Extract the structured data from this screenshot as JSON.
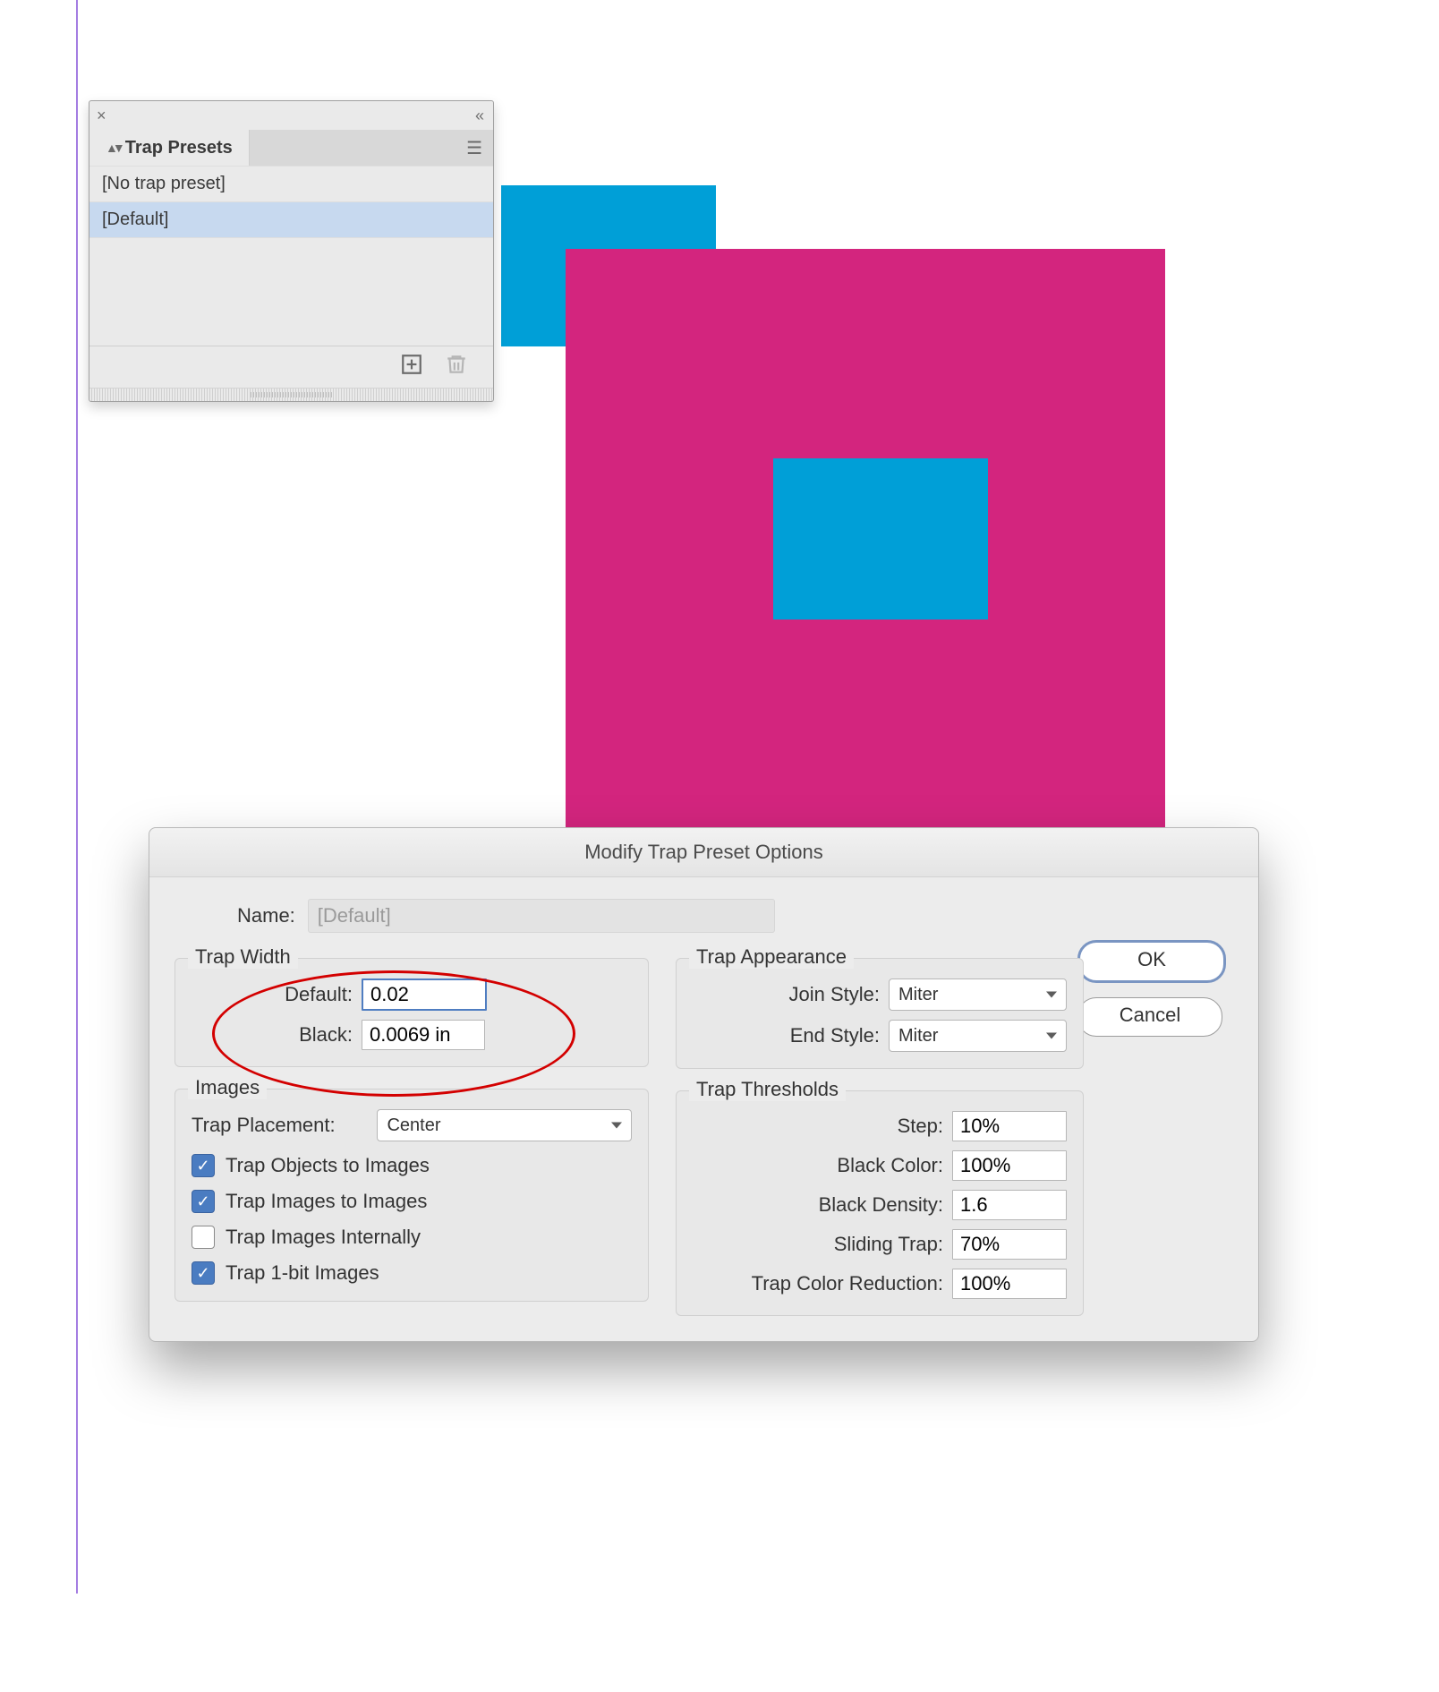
{
  "palette": {
    "title": "Trap Presets",
    "items": [
      {
        "label": "[No trap preset]",
        "selected": false
      },
      {
        "label": "[Default]",
        "selected": true
      }
    ]
  },
  "shapes": {
    "blue1": "#009fd7",
    "magenta": "#d3257e",
    "blue2": "#009fd7"
  },
  "dialog": {
    "title": "Modify Trap Preset Options",
    "name_label": "Name:",
    "name_value": "[Default]",
    "buttons": {
      "ok": "OK",
      "cancel": "Cancel"
    },
    "groups": {
      "trap_width": {
        "legend": "Trap Width",
        "default_label": "Default:",
        "default_value": "0.02",
        "black_label": "Black:",
        "black_value": "0.0069 in"
      },
      "trap_appearance": {
        "legend": "Trap Appearance",
        "join_label": "Join Style:",
        "join_value": "Miter",
        "end_label": "End Style:",
        "end_value": "Miter"
      },
      "images": {
        "legend": "Images",
        "placement_label": "Trap Placement:",
        "placement_value": "Center",
        "objects_to_images": "Trap Objects to Images",
        "images_to_images": "Trap Images to Images",
        "images_internally": "Trap Images Internally",
        "one_bit": "Trap 1-bit Images",
        "checks": {
          "objects_to_images": true,
          "images_to_images": true,
          "images_internally": false,
          "one_bit": true
        }
      },
      "trap_thresholds": {
        "legend": "Trap Thresholds",
        "step_label": "Step:",
        "step_value": "10%",
        "black_color_label": "Black Color:",
        "black_color_value": "100%",
        "black_density_label": "Black Density:",
        "black_density_value": "1.6",
        "sliding_trap_label": "Sliding Trap:",
        "sliding_trap_value": "70%",
        "color_reduction_label": "Trap Color Reduction:",
        "color_reduction_value": "100%"
      }
    }
  }
}
